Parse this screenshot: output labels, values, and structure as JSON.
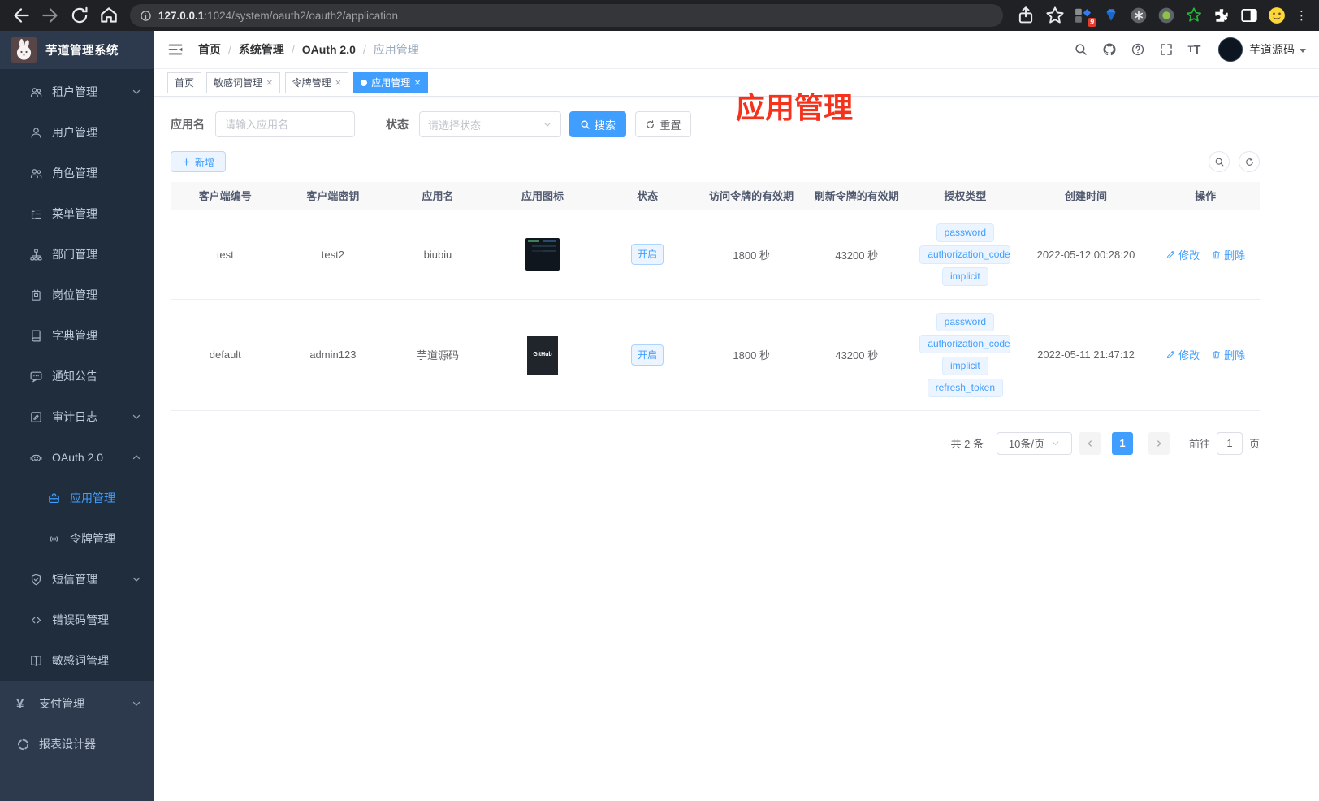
{
  "browser": {
    "url_host": "127.0.0.1",
    "url_rest": ":1024/system/oauth2/oauth2/application",
    "extension_badge": "9"
  },
  "app": {
    "logo_title": "芋道管理系统",
    "user_name": "芋道源码"
  },
  "breadcrumb": [
    "首页",
    "系统管理",
    "OAuth 2.0",
    "应用管理"
  ],
  "tabs": [
    {
      "label": "首页",
      "closable": false,
      "active": false
    },
    {
      "label": "敏感词管理",
      "closable": true,
      "active": false
    },
    {
      "label": "令牌管理",
      "closable": true,
      "active": false
    },
    {
      "label": "应用管理",
      "closable": true,
      "active": true
    }
  ],
  "annotation": {
    "text": "应用管理",
    "color": "#f5321c"
  },
  "sidebar": {
    "sections": [
      {
        "id": "system",
        "items": [
          {
            "id": "tenant",
            "icon": "users",
            "label": "租户管理",
            "chevron": "down"
          },
          {
            "id": "user",
            "icon": "user",
            "label": "用户管理"
          },
          {
            "id": "role",
            "icon": "users",
            "label": "角色管理"
          },
          {
            "id": "menu",
            "icon": "menutree",
            "label": "菜单管理"
          },
          {
            "id": "dept",
            "icon": "org",
            "label": "部门管理"
          },
          {
            "id": "post",
            "icon": "badge",
            "label": "岗位管理"
          },
          {
            "id": "dict",
            "icon": "book",
            "label": "字典管理"
          },
          {
            "id": "notice",
            "icon": "message",
            "label": "通知公告"
          },
          {
            "id": "audit-log",
            "icon": "log",
            "label": "审计日志",
            "chevron": "down"
          },
          {
            "id": "oauth2",
            "icon": "robot",
            "label": "OAuth 2.0",
            "chevron": "up",
            "children": [
              {
                "id": "oauth2-application",
                "icon": "briefcase",
                "label": "应用管理",
                "active": true
              },
              {
                "id": "oauth2-token",
                "icon": "signal",
                "label": "令牌管理"
              }
            ]
          },
          {
            "id": "sms",
            "icon": "shield",
            "label": "短信管理",
            "chevron": "down"
          },
          {
            "id": "error-code",
            "icon": "code",
            "label": "错误码管理"
          },
          {
            "id": "sensitive-word",
            "icon": "openbook",
            "label": "敏感词管理"
          }
        ]
      },
      {
        "id": "bottom",
        "items": [
          {
            "id": "pay",
            "icon": "yen",
            "label": "支付管理",
            "chevron": "down"
          },
          {
            "id": "report-designer",
            "icon": "report",
            "label": "报表设计器"
          }
        ]
      }
    ]
  },
  "filters": {
    "name_label": "应用名",
    "name_placeholder": "请输入应用名",
    "status_label": "状态",
    "status_placeholder": "请选择状态",
    "search_label": "搜索",
    "reset_label": "重置"
  },
  "toolbar": {
    "add_label": "新增"
  },
  "table": {
    "columns": [
      "客户端编号",
      "客户端密钥",
      "应用名",
      "应用图标",
      "状态",
      "访问令牌的有效期",
      "刷新令牌的有效期",
      "授权类型",
      "创建时间",
      "操作"
    ],
    "actions": {
      "edit": "修改",
      "delete": "删除"
    },
    "rows": [
      {
        "client_id": "test",
        "secret": "test2",
        "name": "biubiu",
        "logo_type": "dashboard",
        "logo_text": "",
        "status": "开启",
        "access_ttl": "1800 秒",
        "refresh_ttl": "43200 秒",
        "grant_types": [
          "password",
          "authorization_code",
          "implicit"
        ],
        "created": "2022-05-12 00:28:20"
      },
      {
        "client_id": "default",
        "secret": "admin123",
        "name": "芋道源码",
        "logo_type": "github",
        "logo_text": "GitHub",
        "status": "开启",
        "access_ttl": "1800 秒",
        "refresh_ttl": "43200 秒",
        "grant_types": [
          "password",
          "authorization_code",
          "implicit",
          "refresh_token"
        ],
        "created": "2022-05-11 21:47:12"
      }
    ]
  },
  "pagination": {
    "total_text": "共 2 条",
    "page_size": "10条/页",
    "current_page": "1",
    "goto_label": "前往",
    "goto_value": "1",
    "page_label": "页"
  }
}
